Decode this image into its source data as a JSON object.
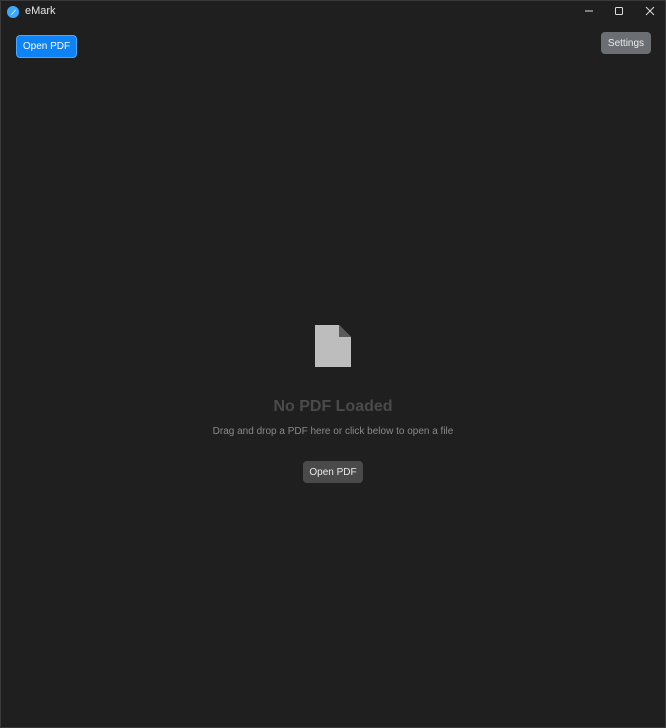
{
  "window": {
    "title": "eMark",
    "icon": "app-logo-icon",
    "controls": {
      "minimize": "minimize-icon",
      "maximize": "maximize-icon",
      "close": "close-icon"
    }
  },
  "toolbar": {
    "open_pdf_label": "Open PDF",
    "settings_label": "Settings"
  },
  "empty_state": {
    "icon": "document-icon",
    "title": "No PDF Loaded",
    "subtitle": "Drag and drop a PDF here or click below to open a file",
    "open_button_label": "Open PDF"
  },
  "colors": {
    "background": "#1f1f1f",
    "primary_button": "#0d83f5",
    "settings_button": "#6b6f74",
    "secondary_button": "#4a4a4a",
    "empty_title": "#4a4a4a",
    "empty_subtitle": "#8a8a8a",
    "document_icon": "#bdbdbd"
  }
}
